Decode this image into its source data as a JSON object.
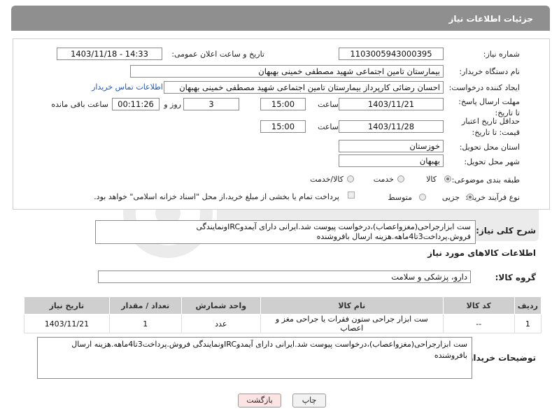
{
  "header": {
    "title": "جزئیات اطلاعات نیاز"
  },
  "form": {
    "need_number_label": "شماره نیاز:",
    "need_number": "1103005943000395",
    "announce_label": "تاریخ و ساعت اعلان عمومی:",
    "announce_value": "1403/11/18 - 14:33",
    "buyer_org_label": "نام دستگاه خریدار:",
    "buyer_org": "بیمارستان تامین اجتماعی شهید مصطفی خمینی بهبهان",
    "requester_label": "ایجاد کننده درخواست:",
    "requester": "احسان رضائی کارپرداز بیمارستان تامین اجتماعی شهید مصطفی خمینی بهبهان",
    "contact_link": "اطلاعات تماس خریدار",
    "deadline_label": "مهلت ارسال پاسخ: تا تاریخ:",
    "deadline_date": "1403/11/21",
    "time_label": "ساعت",
    "deadline_time": "15:00",
    "days": "3",
    "days_label": "روز و",
    "remaining": "00:11:26",
    "remaining_label": "ساعت باقی مانده",
    "validity_label": "حداقل تاریخ اعتبار قیمت: تا تاریخ:",
    "validity_date": "1403/11/28",
    "validity_time": "15:00",
    "province_label": "استان محل تحویل:",
    "province": "خوزستان",
    "city_label": "شهر محل تحویل:",
    "city": "بهبهان",
    "category_label": "طبقه بندی موضوعی:",
    "category_options": [
      "کالا",
      "خدمت",
      "کالا/خدمت"
    ],
    "purchase_type_label": "نوع فرآیند خرید :",
    "purchase_options": [
      "جزیی",
      "متوسط"
    ],
    "payment_note": "پرداخت تمام یا بخشی از مبلغ خرید،از محل \"اسناد خزانه اسلامی\" خواهد بود."
  },
  "summary": {
    "label": "شرح کلی نیاز:",
    "text": "ست ابزارجراحی(مغزواعصاب)،درخواست پیوست شد.ایرانی دارای آیمدوIRCونمایندگی فروش.پرداخت3تا4ماهه.هزینه ارسال بافروشنده"
  },
  "goods_info_title": "اطلاعات کالاهای مورد نیاز",
  "goods_group": {
    "label": "گروه کالا:",
    "value": "دارو، پزشکی و سلامت"
  },
  "table": {
    "headers": [
      "ردیف",
      "کد کالا",
      "نام کالا",
      "واحد شمارش",
      "تعداد / مقدار",
      "تاریخ نیاز"
    ],
    "rows": [
      {
        "row": "1",
        "code": "--",
        "name": "ست ابزار جراحی ستون فقرات یا جراحی مغز و اعصاب",
        "unit": "عدد",
        "qty": "1",
        "date": "1403/11/21"
      }
    ]
  },
  "buyer_notes": {
    "label": "توضیحات خریدار:",
    "text": "ست ابزارجراحی(مغزواعصاب)،درخواست پیوست شد.ایرانی دارای آیمدوIRCونمایندگی فروش.پرداخت3تا4ماهه.هزینه ارسال بافروشنده"
  },
  "buttons": {
    "print": "چاپ",
    "back": "بازگشت"
  },
  "colors": {
    "header_bg": "#8f8f8f",
    "link": "#1a57c9",
    "back_bg": "#fde4e4"
  }
}
